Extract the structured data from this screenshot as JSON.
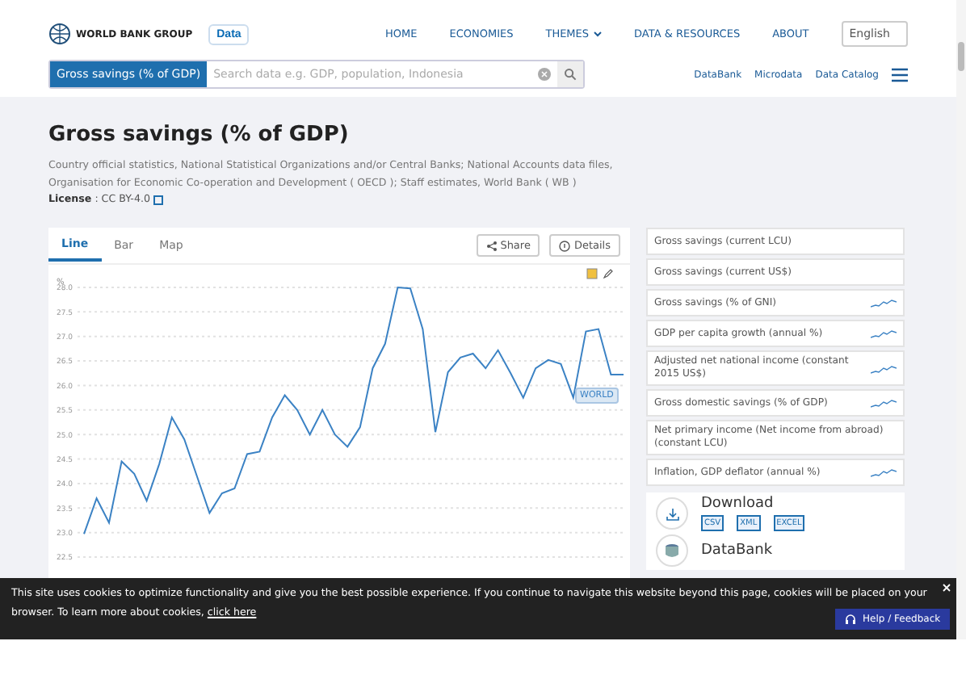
{
  "header": {
    "logo": "WORLD BANK GROUP",
    "data_button": "Data",
    "nav": [
      {
        "label": "HOME",
        "caret": false
      },
      {
        "label": "ECONOMIES",
        "caret": false
      },
      {
        "label": "THEMES",
        "caret": true
      },
      {
        "label": "DATA & RESOURCES",
        "caret": false
      },
      {
        "label": "ABOUT",
        "caret": false
      }
    ],
    "language": "English"
  },
  "search": {
    "chip": "Gross savings (% of GDP)",
    "placeholder": "Search data e.g. GDP, population, Indonesia"
  },
  "links": [
    "DataBank",
    "Microdata",
    "Data Catalog"
  ],
  "page": {
    "title": "Gross savings (% of GDP)",
    "source": "Country official statistics, National Statistical Organizations and/or Central Banks; National Accounts data files, Organisation for Economic Co-operation and Development ( OECD ); Staff estimates, World Bank ( WB )",
    "license_label": "License",
    "license_value": ": CC BY-4.0"
  },
  "chart_tabs": [
    {
      "label": "Line",
      "selected": true
    },
    {
      "label": "Bar",
      "selected": false
    },
    {
      "label": "Map",
      "selected": false
    }
  ],
  "chart_actions": [
    "Share",
    "Details"
  ],
  "chart": {
    "chart_data": {
      "type": "line",
      "ylabel": "%",
      "grid": true,
      "ylim": [
        22.5,
        28.0
      ],
      "yticks": [
        {
          "value": 22.5,
          "label": "22.5"
        },
        {
          "value": 23,
          "label": "23.0"
        },
        {
          "value": 23.5,
          "label": "23.5"
        },
        {
          "value": 24,
          "label": "24.0"
        },
        {
          "value": 24.5,
          "label": "24.5"
        },
        {
          "value": 25,
          "label": "25.0"
        },
        {
          "value": 25.5,
          "label": "25.5"
        },
        {
          "value": 26,
          "label": "26.0"
        },
        {
          "value": 26.5,
          "label": "26.5"
        },
        {
          "value": 27,
          "label": "27.0"
        },
        {
          "value": 27.5,
          "label": "27.5"
        },
        {
          "value": 28,
          "label": "28.0"
        }
      ],
      "series": [
        {
          "name": "WORLD",
          "color": "#3b82c4",
          "values": [
            22.97,
            23.7,
            23.2,
            24.45,
            24.2,
            23.65,
            24.4,
            25.35,
            24.9,
            24.15,
            23.4,
            23.8,
            23.9,
            24.6,
            24.65,
            25.35,
            25.8,
            25.5,
            25.0,
            25.5,
            25.0,
            24.75,
            25.15,
            26.35,
            26.85,
            28.0,
            27.98,
            27.15,
            25.05,
            26.27,
            26.57,
            26.65,
            26.35,
            26.72,
            26.25,
            25.75,
            26.35,
            26.52,
            26.44,
            25.75,
            27.1,
            27.15,
            26.22,
            26.22
          ]
        }
      ]
    }
  },
  "related": [
    {
      "label": "Gross savings (current LCU)",
      "sparkline": false
    },
    {
      "label": "Gross savings (current US$)",
      "sparkline": false
    },
    {
      "label": "Gross savings (% of GNI)",
      "sparkline": true
    },
    {
      "label": "GDP per capita growth (annual %)",
      "sparkline": true
    },
    {
      "label": "Adjusted net national income (constant 2015 US$)",
      "sparkline": true
    },
    {
      "label": "Gross domestic savings (% of GDP)",
      "sparkline": true
    },
    {
      "label": "Net primary income (Net income from abroad) (constant LCU)",
      "sparkline": false
    },
    {
      "label": "Inflation, GDP deflator (annual %)",
      "sparkline": true
    }
  ],
  "download": {
    "title": "Download",
    "formats": [
      "CSV",
      "XML",
      "EXCEL"
    ]
  },
  "resources": [
    {
      "title": "DataBank"
    }
  ],
  "cookie": {
    "text": "This site uses cookies to optimize functionality and give you the best possible experience. If you continue to navigate this website beyond this page, cookies will be placed on your browser. To learn more about cookies,",
    "link": "click here"
  },
  "help": "Help / Feedback"
}
